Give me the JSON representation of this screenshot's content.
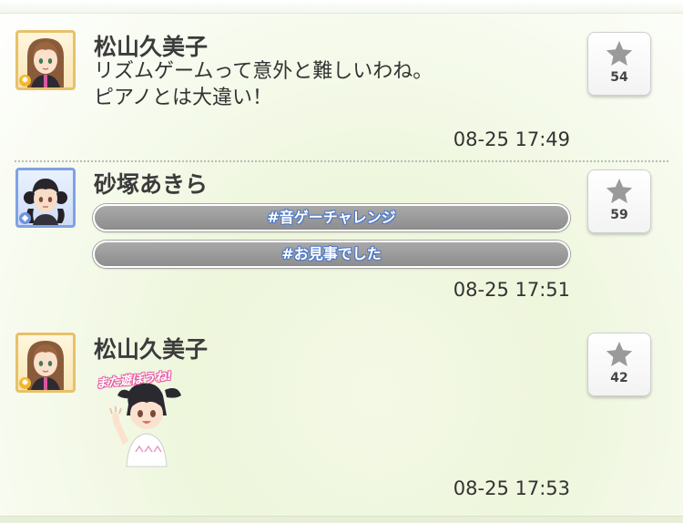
{
  "timeline": {
    "posts": [
      {
        "author": "松山久美子",
        "avatar_icon": "avatar-kumiko-icon",
        "badge_icon": "sun-attribute-icon",
        "message_lines": [
          "リズムゲームって意外と難しいわね。",
          "ピアノとは大違い！"
        ],
        "timestamp": "08-25 17:49",
        "like_count": "54"
      },
      {
        "author": "砂塚あきら",
        "avatar_icon": "avatar-akira-icon",
        "badge_icon": "gem-attribute-icon",
        "tags": [
          "#音ゲーチャレンジ",
          "#お見事でした"
        ],
        "timestamp": "08-25 17:51",
        "like_count": "59"
      },
      {
        "author": "松山久美子",
        "avatar_icon": "avatar-kumiko-icon",
        "badge_icon": "sun-attribute-icon",
        "stamp_text": "また遊ぼうね!",
        "stamp_icon": "waving-girl-stamp",
        "timestamp": "08-25 17:53",
        "like_count": "42"
      }
    ]
  },
  "colors": {
    "tag_fill": "#999999",
    "tag_text_outline": "#4d79c8",
    "passion_frame": "#e7c16a",
    "cool_frame": "#7fa2e4",
    "stamp_text_outline": "#ea5fa4"
  }
}
